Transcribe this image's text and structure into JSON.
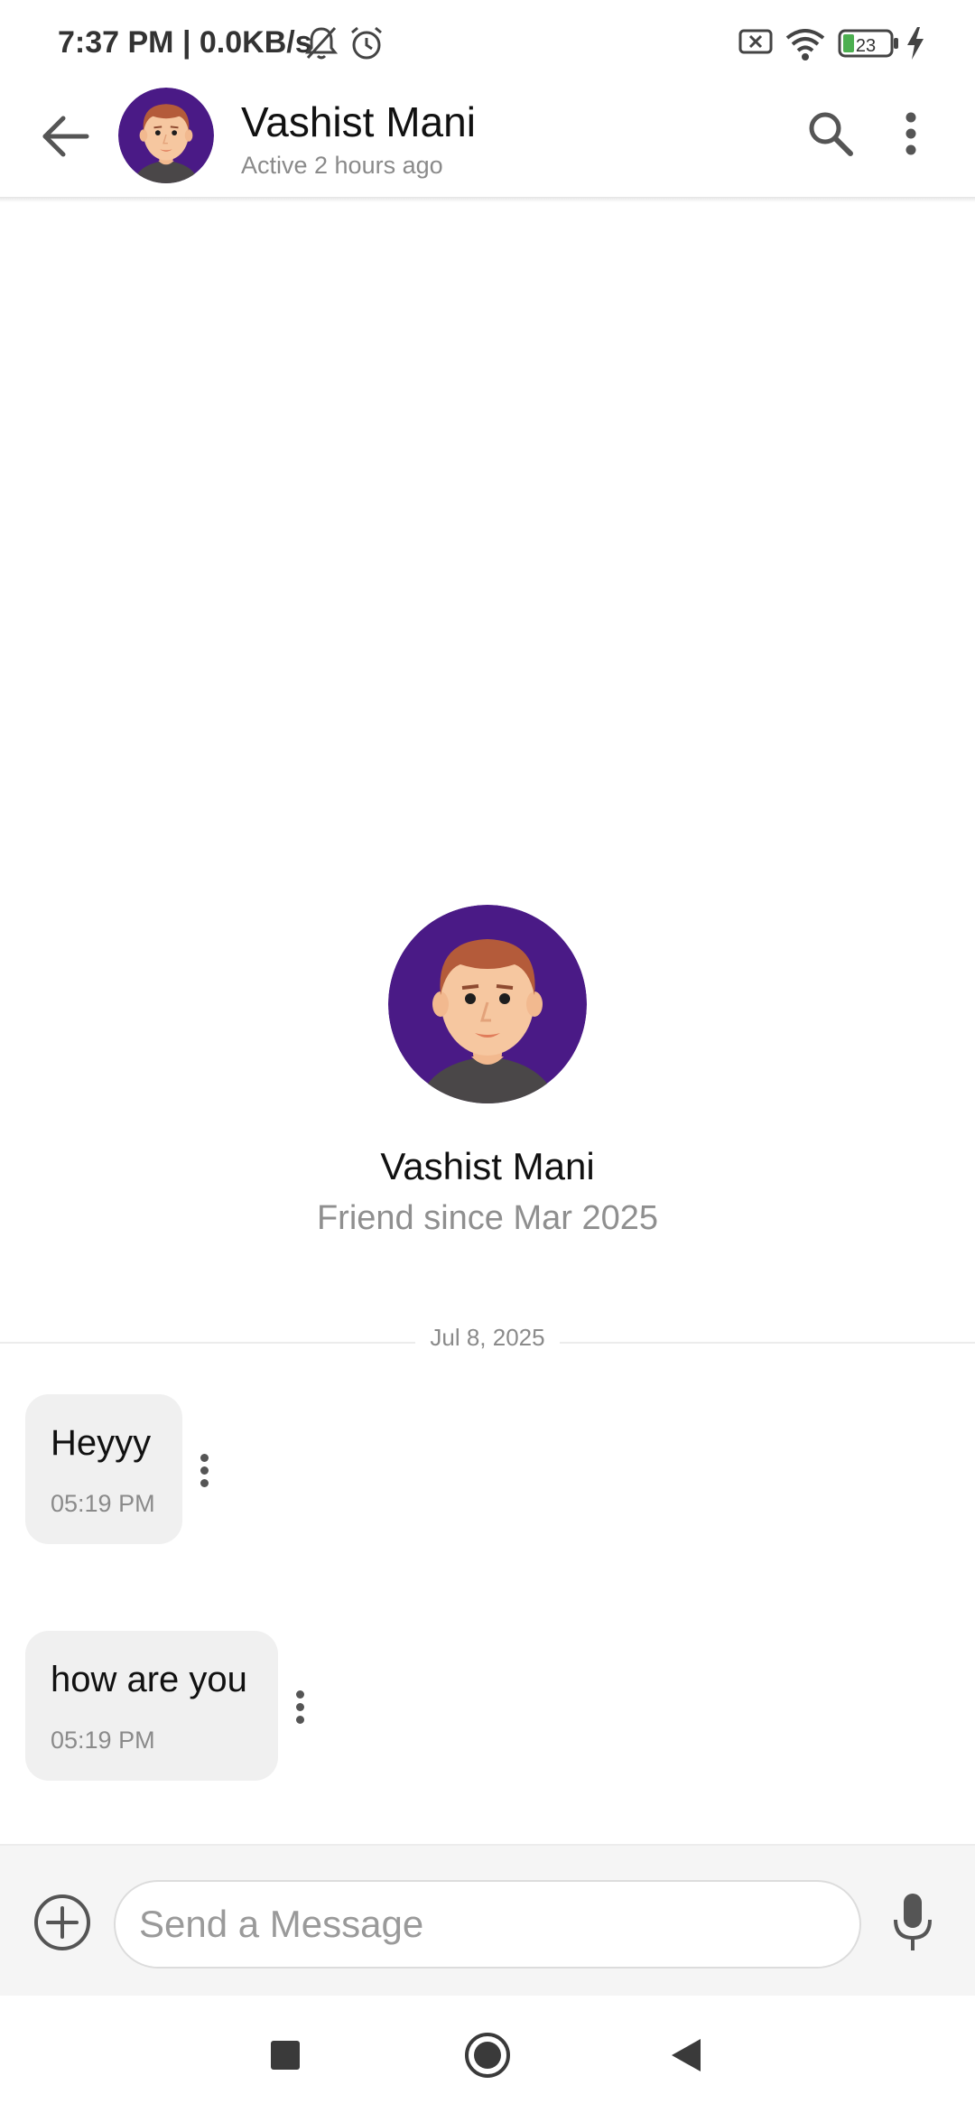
{
  "status_bar": {
    "time": "7:37 PM | 0.0KB/s",
    "battery": "23",
    "icons": [
      "bell-off-icon",
      "alarm-icon",
      "sim-off-icon",
      "wifi-icon",
      "battery-icon",
      "charging-icon"
    ]
  },
  "header": {
    "contact_name": "Vashist Mani",
    "contact_status": "Active 2 hours ago",
    "icons": [
      "back-arrow-icon",
      "search-icon",
      "more-vert-icon"
    ]
  },
  "profile": {
    "name": "Vashist Mani",
    "friend_since": "Friend since Mar 2025"
  },
  "conversation": {
    "date_divider": "Jul 8, 2025",
    "messages": [
      {
        "text": "Heyyy",
        "time": "05:19 PM"
      },
      {
        "text": "how are you",
        "time": "05:19 PM"
      }
    ]
  },
  "composer": {
    "placeholder": "Send a Message",
    "value": ""
  },
  "colors": {
    "avatar_bg": "#4a1a86",
    "bubble_bg": "#f0f0f0",
    "icon_gray": "#555555"
  }
}
